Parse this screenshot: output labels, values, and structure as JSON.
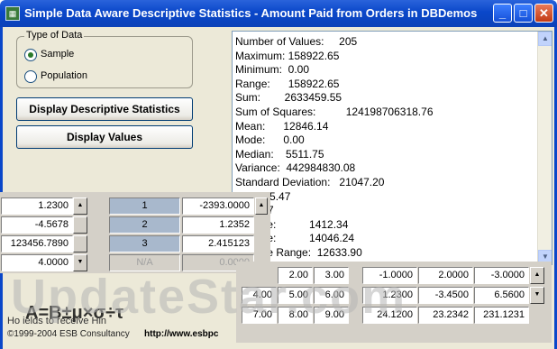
{
  "window": {
    "title": "Simple Data Aware Descriptive Statistics - Amount Paid from Orders in DBDemos",
    "icon": "grid-app-icon",
    "min_glyph": "_",
    "max_glyph": "□",
    "close_glyph": "✕"
  },
  "group": {
    "legend": "Type of Data",
    "options": [
      {
        "label": "Sample",
        "checked": true
      },
      {
        "label": "Population",
        "checked": false
      }
    ]
  },
  "buttons": {
    "stats": "Display Descriptive Statistics",
    "values": "Display Values"
  },
  "stats_lines": [
    "Number of Values:     205",
    "Maximum: 158922.65",
    "Minimum:  0.00",
    "Range:      158922.65",
    "Sum:        2633459.55",
    "Sum of Squares:          124198706318.76",
    "Mean:      12846.14",
    "Mode:      0.00",
    "Median:    5511.75",
    "Variance:  442984830.08",
    "Standard Deviation:   21047.20",
    "osis:  15.47",
    "v:   3.47",
    "Quartile:           1412.34",
    "Quartile:           14046.24",
    "Quartile Range:  12633.90"
  ],
  "left_grid": {
    "values": [
      "1.2300",
      "-4.5678",
      "123456.7890",
      "4.0000"
    ],
    "headers": [
      "1",
      "2",
      "3",
      "N/A"
    ],
    "results": [
      "-2393.0000",
      "1.2352",
      "2.415123",
      "0.0000"
    ]
  },
  "right_grid": {
    "small": [
      [
        "2.00",
        "3.00"
      ],
      [
        "4.00",
        "5.00",
        "6.00"
      ],
      [
        "7.00",
        "8.00",
        "9.00"
      ]
    ],
    "big": [
      [
        "-1.0000",
        "2.0000",
        "-3.0000"
      ],
      [
        "1.2300",
        "-3.4500",
        "6.5600"
      ],
      [
        "24.1200",
        "23.2342",
        "231.1231"
      ]
    ]
  },
  "footer": {
    "hint": "Ho                              ields to receive Hin",
    "copyright": "©1999-2004 ESB Consultancy",
    "url": "http://www.esbpc",
    "formula": "A=B±μ×σ÷τ"
  },
  "watermark": "UpdateStar.com"
}
